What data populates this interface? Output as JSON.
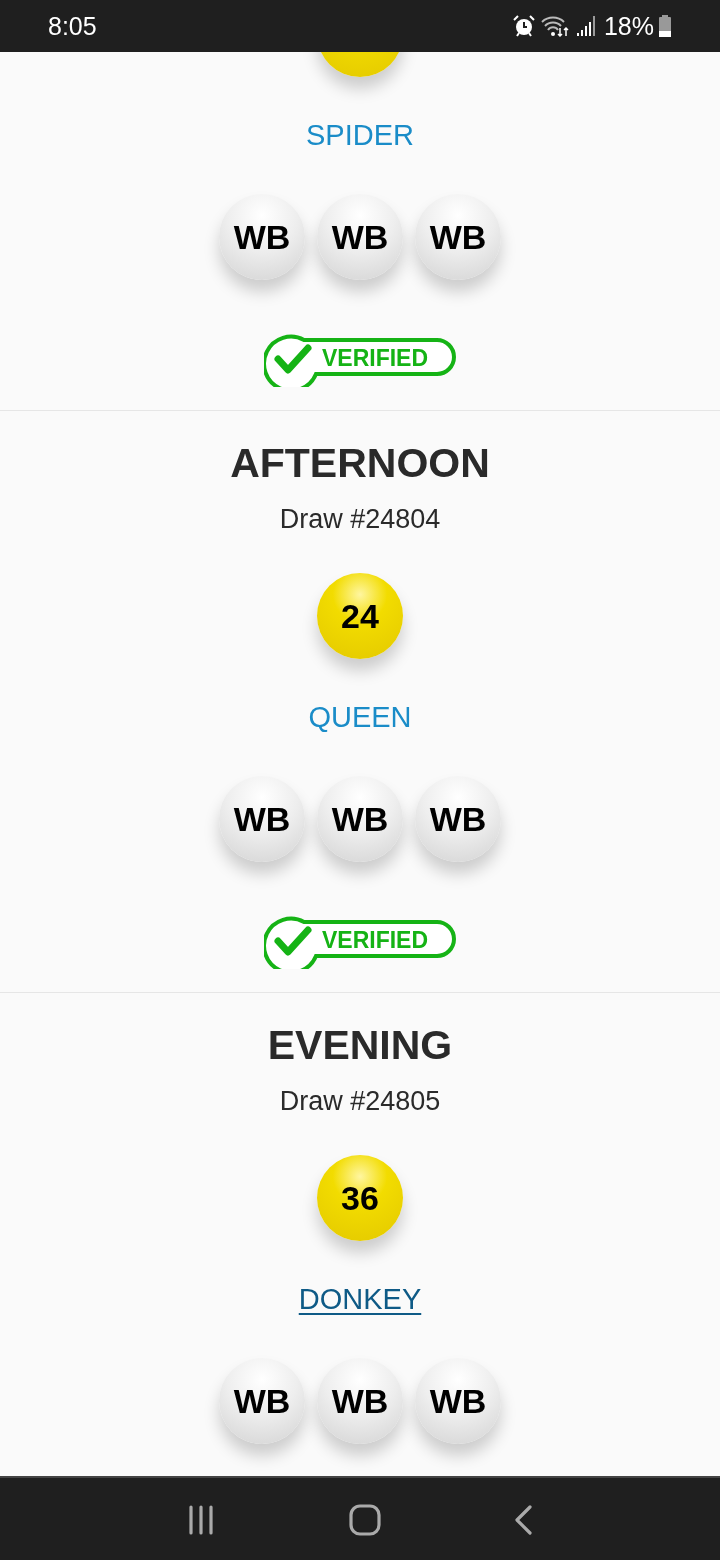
{
  "status_bar": {
    "time": "8:05",
    "battery": "18%"
  },
  "draws": [
    {
      "animal": {
        "text": "SPIDER",
        "focused": false
      },
      "white_balls": [
        "WB",
        "WB",
        "WB"
      ],
      "badge": "VERIFIED"
    },
    {
      "title": "AFTERNOON",
      "draw": "Draw #24804",
      "number": "24",
      "animal": {
        "text": "QUEEN",
        "focused": false
      },
      "white_balls": [
        "WB",
        "WB",
        "WB"
      ],
      "badge": "VERIFIED"
    },
    {
      "title": "EVENING",
      "draw": "Draw #24805",
      "number": "36",
      "animal": {
        "text": "DONKEY",
        "focused": true
      },
      "white_balls": [
        "WB",
        "WB",
        "WB"
      ]
    }
  ]
}
